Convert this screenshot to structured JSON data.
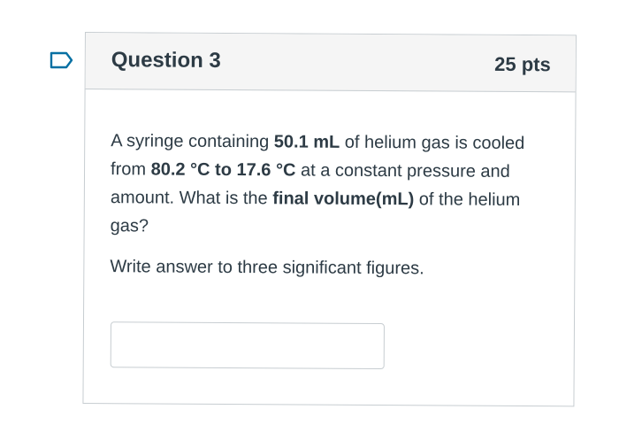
{
  "question": {
    "title": "Question 3",
    "points": "25 pts",
    "flag_icon": "bookmark-flag-icon",
    "text": {
      "t1": "A syringe containing ",
      "b1": "50.1 mL",
      "t2": " of helium gas is cooled from ",
      "b2": "80.2 °C to 17.6 °C",
      "t3": " at a constant pressure and amount.  What is the ",
      "b3": "final volume(mL)",
      "t4": " of the helium gas?"
    },
    "instruction": "Write answer to three significant figures.",
    "answer": {
      "value": "",
      "placeholder": ""
    }
  },
  "colors": {
    "text": "#2d3b45",
    "border": "#c7cdd1",
    "header_bg": "#f5f5f5",
    "flag": "#0770a3"
  }
}
